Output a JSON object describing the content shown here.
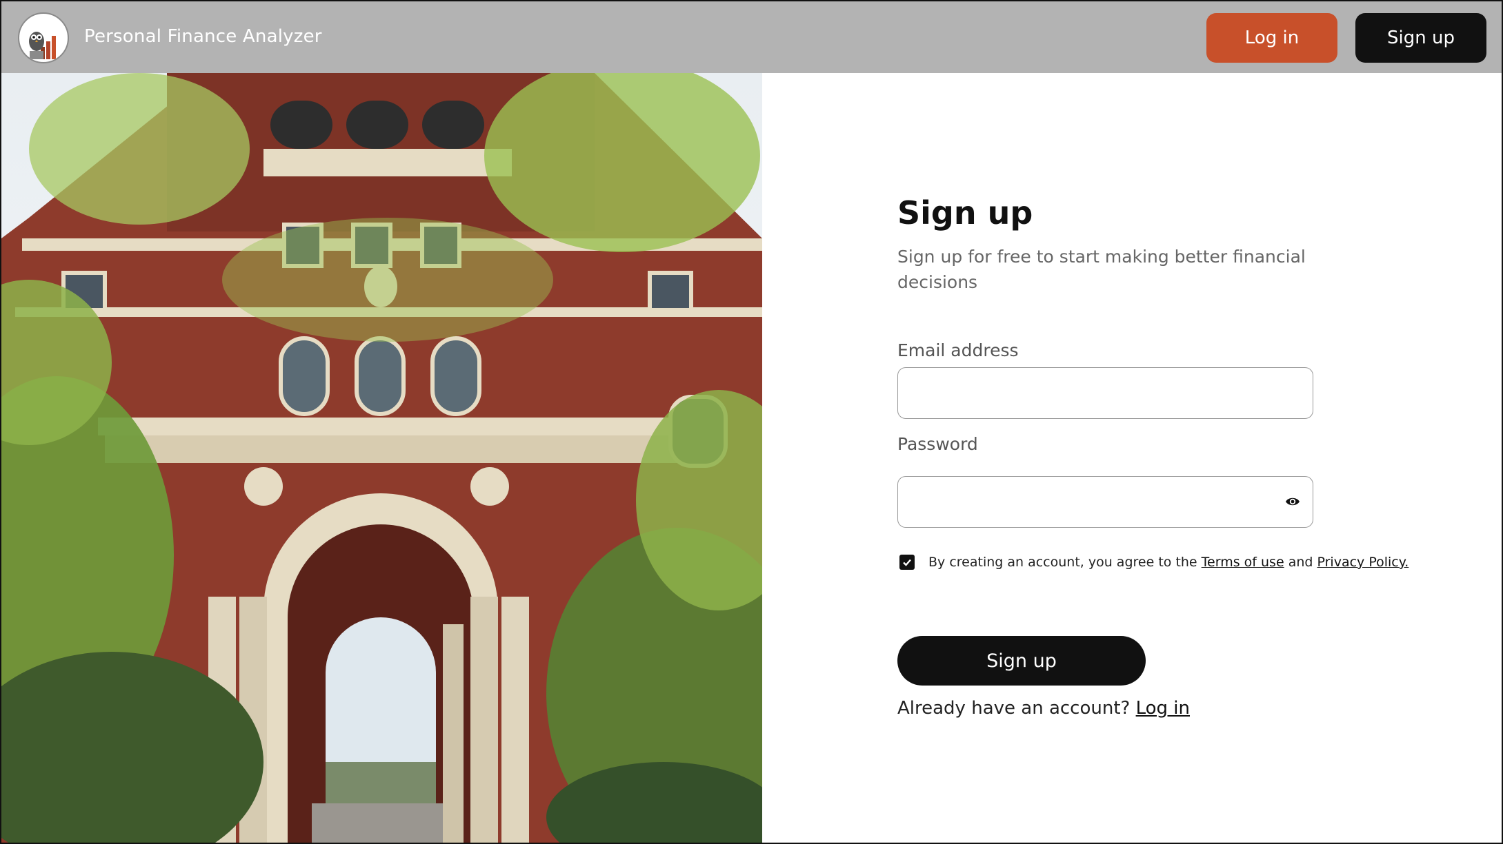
{
  "app": {
    "title": "Personal Finance Analyzer",
    "logo_icon": "owl-bar-chart-logo-icon"
  },
  "header": {
    "login_label": "Log in",
    "signup_label": "Sign up"
  },
  "hero": {
    "image": "brick-building-archway-photo"
  },
  "form": {
    "title": "Sign up",
    "subtitle": "Sign up for free to start making better financial decisions",
    "email_label": "Email address",
    "email_value": "",
    "password_label": "Password",
    "password_value": "",
    "show_password_icon": "eye-icon",
    "agree": {
      "checked": true,
      "prefix": "By creating an account, you agree to the ",
      "terms_link": "Terms of use",
      "and": " and ",
      "privacy_link": "Privacy Policy."
    },
    "submit_label": "Sign up",
    "already_text": "Already have an account? ",
    "login_link": "Log in"
  },
  "colors": {
    "header_bg": "#b3b3b3",
    "accent": "#c8502a",
    "dark": "#111111"
  }
}
